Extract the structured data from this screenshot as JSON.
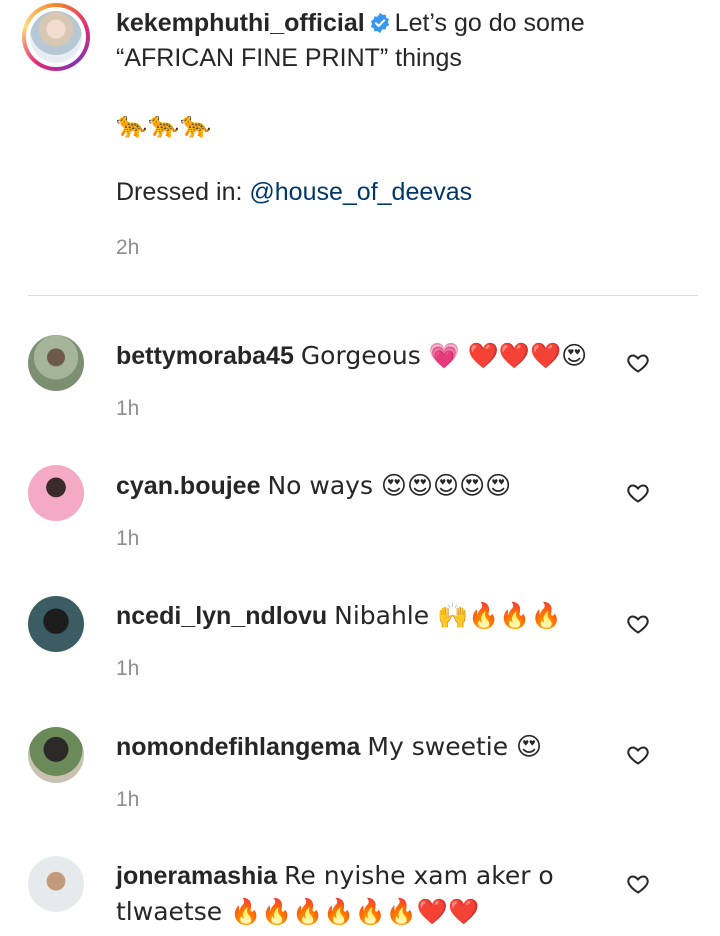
{
  "post": {
    "username": "kekemphuthi_official",
    "caption_line": "Let’s go do some “AFRICAN FINE PRINT” things",
    "emoji_line": "🐆🐆🐆",
    "dressed_prefix": "Dressed in: ",
    "dressed_mention": "@house_of_deevas",
    "time": "2h"
  },
  "comments": [
    {
      "username": "bettymoraba45",
      "text": "Gorgeous 💗 ❤️❤️❤️😍",
      "time": "1h"
    },
    {
      "username": "cyan.boujee",
      "text": "No ways 😍😍😍😍😍",
      "time": "1h"
    },
    {
      "username": "ncedi_lyn_ndlovu",
      "text": "Nibahle 🙌🔥🔥🔥",
      "time": "1h"
    },
    {
      "username": "nomondefihlangema",
      "text": "My sweetie 😍",
      "time": "1h"
    },
    {
      "username": "joneramashia",
      "text": "Re nyishe xam aker o tlwaetse 🔥🔥🔥🔥🔥🔥❤️❤️",
      "time": "1h"
    }
  ],
  "colors": {
    "text": "#262626",
    "secondary": "#8e8e8e",
    "mention": "#00376b",
    "verified": "#3897f0",
    "divider": "#dbdbdb"
  },
  "icons": {
    "verified": "verified-badge-icon",
    "like": "heart-outline-icon"
  }
}
